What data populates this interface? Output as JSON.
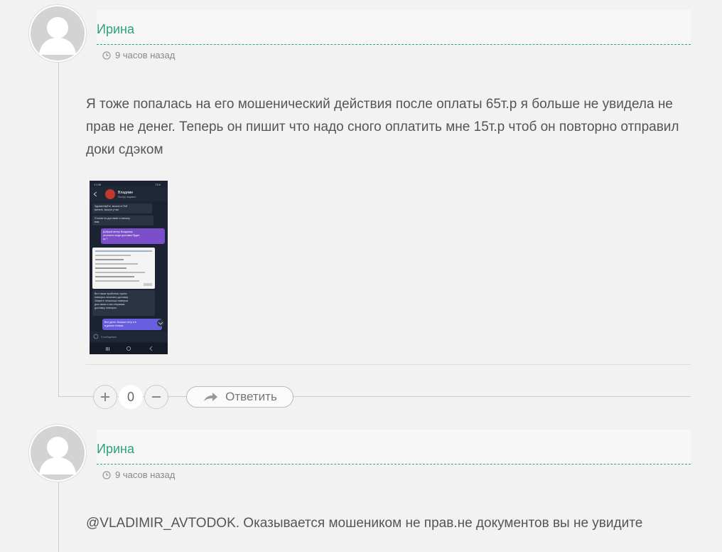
{
  "comments": [
    {
      "author": "Ирина",
      "time": "9 часов назад",
      "text": "Я тоже попалась на его мошенический действия после оплаты 65т.р я больше не увидела не прав не денег. Теперь он пишит что надо сного оплатить мне 15т.р чтоб он повторно отправил доки сдэком",
      "votes": "0",
      "reply_label": "Ответить",
      "attachment": {
        "contact_name": "Владими",
        "contact_status": "был(а) недавно",
        "status_time": "17:08",
        "battery": "71%",
        "messages": [
          {
            "dir": "in",
            "text": "Здравствуйте, можно в ГАИ менять, можно у нас",
            "time": "15:00"
          },
          {
            "dir": "in",
            "text": "Уточню по доставке и напишу вам",
            "time": "15:00"
          },
          {
            "dir": "out",
            "text": "Добрый вечер Владимир уточнили когда доставка будет ку ?",
            "time": "11:53"
          },
          {
            "dir": "in",
            "text": "Вот такая проблема, нужно повторно оплатить доставку Укажите несколько номеров для связи и мы отправим доставку повторно.",
            "time": "11:55"
          },
          {
            "dir": "out",
            "text": "Все денег больше нету я в в долгах теперь",
            "time": "11:56"
          }
        ],
        "input_placeholder": "Сообщение"
      }
    },
    {
      "author": "Ирина",
      "time": "9 часов назад",
      "text": "@VLADIMIR_AVTODOK. Оказывается мошеником не прав.не документов вы не увидите"
    }
  ],
  "colors": {
    "author": "#2aa37c",
    "background": "#f2f2f2",
    "header_bar": "#f7f7f7"
  },
  "icons": {
    "time": "clock-icon",
    "reply": "reply-arrow-icon",
    "upvote": "plus-icon",
    "downvote": "minus-icon"
  }
}
